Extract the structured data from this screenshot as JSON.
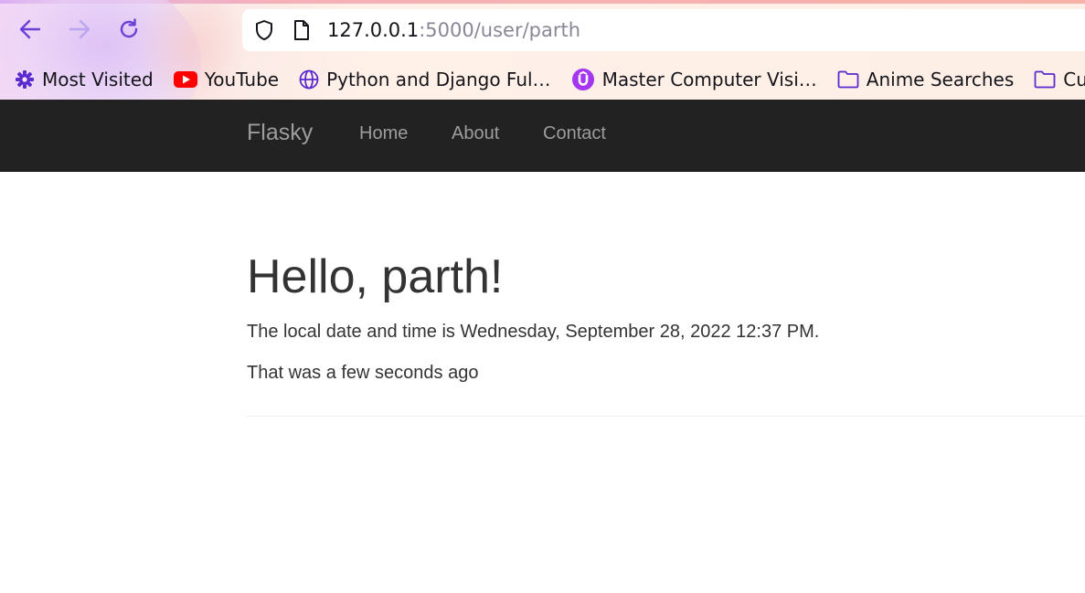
{
  "browser": {
    "url_host": "127.0.0.1",
    "url_path": ":5000/user/parth",
    "bookmarks": [
      {
        "label": "Most Visited",
        "icon": "gear-icon"
      },
      {
        "label": "YouTube",
        "icon": "youtube-icon"
      },
      {
        "label": "Python and Django Ful…",
        "icon": "globe-icon"
      },
      {
        "label": "Master Computer Visi…",
        "icon": "udemy-icon"
      },
      {
        "label": "Anime Searches",
        "icon": "folder-icon"
      },
      {
        "label": "Curr",
        "icon": "folder-icon"
      }
    ],
    "accent_color": "#7542e5"
  },
  "navbar": {
    "brand": "Flasky",
    "links": [
      "Home",
      "About",
      "Contact"
    ],
    "background": "#222222"
  },
  "page": {
    "heading": "Hello, parth!",
    "datetime_line": "The local date and time is Wednesday, September 28, 2022 12:37 PM.",
    "relative_line": "That was a few seconds ago"
  }
}
